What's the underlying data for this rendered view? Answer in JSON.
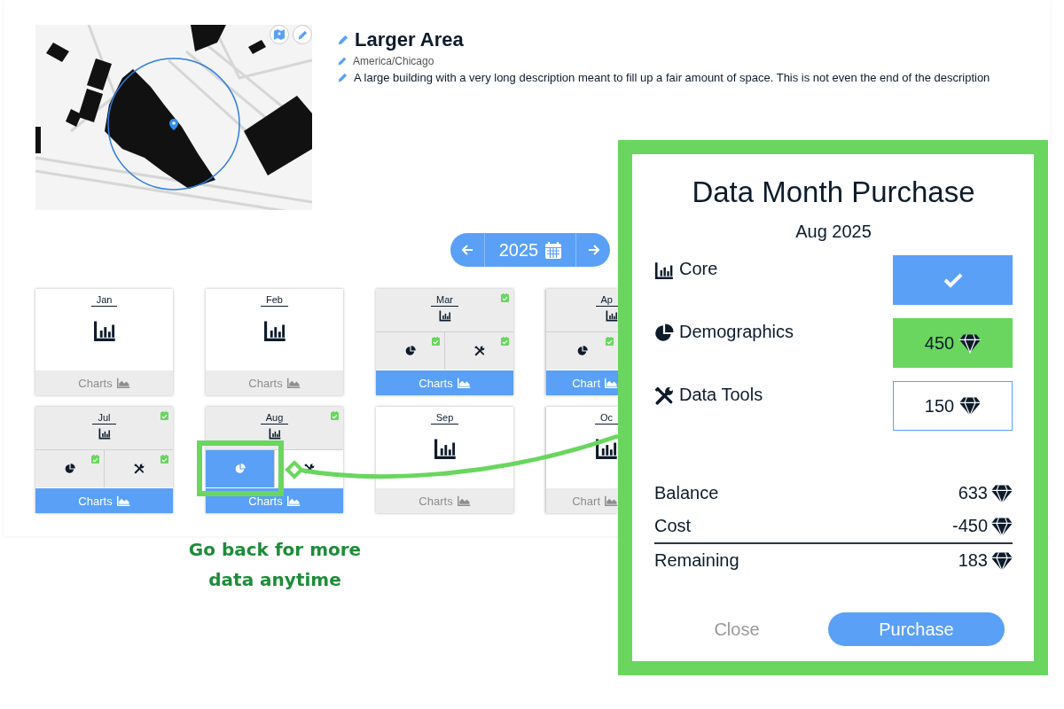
{
  "place": {
    "title": "Larger Area",
    "timezone": "America/Chicago",
    "description": "A large building with a very long description meant to fill up a fair amount of space. This is not even the end of the description"
  },
  "year_nav": {
    "year": "2025"
  },
  "months": [
    {
      "label": "Jan",
      "core_owned": false,
      "charts_label": "Charts",
      "charts_enabled": false
    },
    {
      "label": "Feb",
      "core_owned": false,
      "charts_label": "Charts",
      "charts_enabled": false
    },
    {
      "label": "Mar",
      "core_owned": true,
      "charts_label": "Charts",
      "charts_enabled": true,
      "addons": [
        {
          "kind": "demographics",
          "owned": true,
          "selected": false
        },
        {
          "kind": "tools",
          "owned": true,
          "selected": false
        }
      ]
    },
    {
      "label": "Ap",
      "core_owned": true,
      "charts_label": "Chart",
      "charts_enabled": true,
      "addons": [
        {
          "kind": "demographics",
          "owned": true,
          "selected": false
        }
      ]
    },
    {
      "label": "Jul",
      "core_owned": true,
      "charts_label": "Charts",
      "charts_enabled": true,
      "addons": [
        {
          "kind": "demographics",
          "owned": true,
          "selected": false
        },
        {
          "kind": "tools",
          "owned": true,
          "selected": false
        }
      ]
    },
    {
      "label": "Aug",
      "core_owned": true,
      "charts_label": "Charts",
      "charts_enabled": true,
      "addons": [
        {
          "kind": "demographics",
          "owned": false,
          "selected": true
        },
        {
          "kind": "tools",
          "owned": false,
          "selected": false
        }
      ]
    },
    {
      "label": "Sep",
      "core_owned": false,
      "charts_label": "Charts",
      "charts_enabled": false
    },
    {
      "label": "Oc",
      "core_owned": false,
      "charts_label": "Chart",
      "charts_enabled": false
    }
  ],
  "dialog": {
    "title": "Data Month Purchase",
    "subtitle": "Aug 2025",
    "options": [
      {
        "kind": "core",
        "label": "Core",
        "owned": true,
        "selected": false
      },
      {
        "kind": "demographics",
        "label": "Demographics",
        "price": "450",
        "owned": false,
        "selected": true
      },
      {
        "kind": "tools",
        "label": "Data Tools",
        "price": "150",
        "owned": false,
        "selected": false
      }
    ],
    "summary": [
      {
        "label": "Balance",
        "value": "633",
        "kind": "line"
      },
      {
        "label": "Cost",
        "value": "-450",
        "kind": "line"
      },
      {
        "label": "Remaining",
        "value": "183",
        "kind": "total"
      }
    ],
    "close_label": "Close",
    "purchase_label": "Purchase"
  },
  "caption": "Go back for more data anytime"
}
